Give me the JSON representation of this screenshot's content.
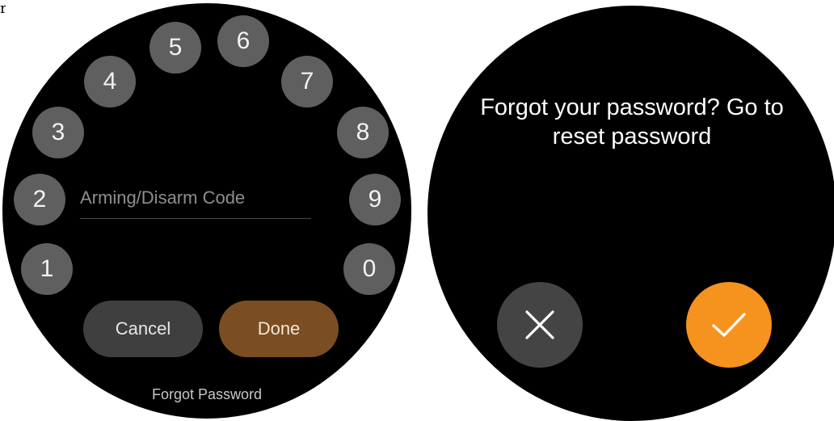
{
  "corner_glyph": "r",
  "keypad": {
    "keys": [
      "1",
      "2",
      "3",
      "4",
      "5",
      "6",
      "7",
      "8",
      "9",
      "0"
    ]
  },
  "code_input": {
    "placeholder": "Arming/Disarm Code",
    "value": ""
  },
  "actions": {
    "cancel_label": "Cancel",
    "done_label": "Done"
  },
  "forgot_link": "Forgot Password",
  "reset_dialog": {
    "message": "Forgot your password? Go to reset password",
    "dismiss_icon": "close-icon",
    "confirm_icon": "check-icon"
  },
  "colors": {
    "key_bg": "#5f5f5f",
    "cancel_bg": "#3f3f3f",
    "done_bg": "#7a4e22",
    "confirm_bg": "#f6921e",
    "dismiss_bg": "#444444"
  }
}
